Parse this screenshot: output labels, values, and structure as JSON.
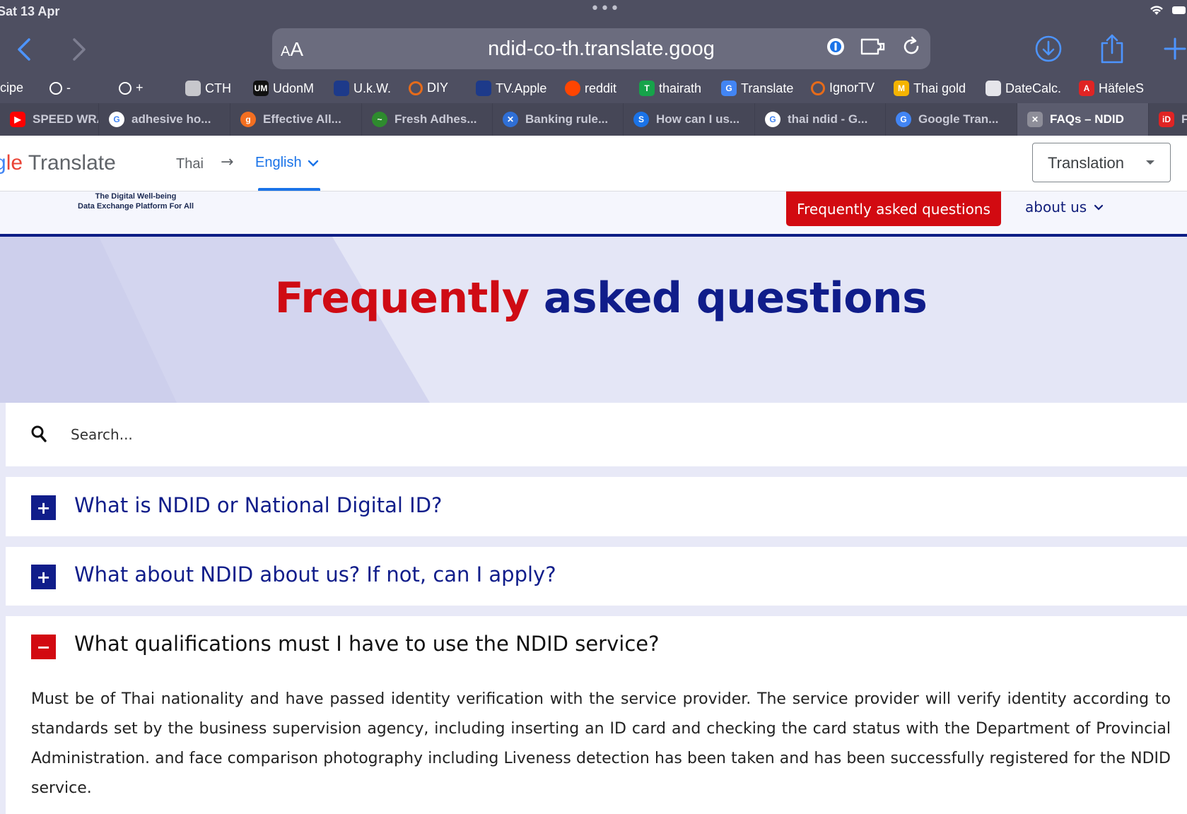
{
  "status": {
    "time": "Sat 13 Apr"
  },
  "url_bar": {
    "aa_small": "A",
    "aa_big": "A",
    "url": "ndid-co-th.translate.goog"
  },
  "bookmarks": [
    {
      "label": "ecipe",
      "icon": "recipe-icon",
      "color": "#4e4f61"
    },
    {
      "label": "-",
      "icon": "globe-icon",
      "color": "#4e4f61"
    },
    {
      "label": "+",
      "icon": "globe-icon",
      "color": "#4e4f61"
    },
    {
      "label": "CTH",
      "icon": "apple-icon",
      "color": "#c7c7cc"
    },
    {
      "label": "UdonM",
      "icon": "um-icon",
      "color": "#111111",
      "glyph": "UM"
    },
    {
      "label": "U.k.W.",
      "icon": "uk-flag-icon",
      "color": "#1d3a8a"
    },
    {
      "label": "DIY",
      "icon": "ring-icon",
      "color": "#e66b1a"
    },
    {
      "label": "TV.Apple",
      "icon": "uk-flag-icon",
      "color": "#1d3a8a"
    },
    {
      "label": "reddit",
      "icon": "reddit-icon",
      "color": "#ff4500"
    },
    {
      "label": "thairath",
      "icon": "thairath-icon",
      "color": "#16a34a",
      "glyph": "T"
    },
    {
      "label": "Translate",
      "icon": "google-translate-icon",
      "color": "#4285f4",
      "glyph": "G"
    },
    {
      "label": "IgnorTV",
      "icon": "ring-icon",
      "color": "#e66b1a"
    },
    {
      "label": "Thai gold",
      "icon": "gold-icon",
      "color": "#f5b400",
      "glyph": "M"
    },
    {
      "label": "DateCalc.",
      "icon": "datecalc-icon",
      "color": "#e5e5ea"
    },
    {
      "label": "HäfeleS",
      "icon": "hafele-icon",
      "color": "#e02424",
      "glyph": "A"
    }
  ],
  "tabs": [
    {
      "label": "SPEED WRA",
      "icon": "youtube-icon",
      "color": "#ff0000",
      "glyph": "▶"
    },
    {
      "label": "adhesive ho...",
      "icon": "google-icon",
      "color": "#ffffff",
      "glyph": "G"
    },
    {
      "label": "Effective All...",
      "icon": "gsk-icon",
      "color": "#f36f21",
      "glyph": "g"
    },
    {
      "label": "Fresh Adhes...",
      "icon": "fresh-icon",
      "color": "#2e8b2e",
      "glyph": "~"
    },
    {
      "label": "Banking rule...",
      "icon": "banking-icon",
      "color": "#2f6fd6",
      "glyph": "✕"
    },
    {
      "label": "How can I us...",
      "icon": "skype-icon",
      "color": "#1a73e8",
      "glyph": "S"
    },
    {
      "label": "thai ndid - G...",
      "icon": "google-icon",
      "color": "#ffffff",
      "glyph": "G"
    },
    {
      "label": "Google Tran...",
      "icon": "google-translate-icon",
      "color": "#4285f4",
      "glyph": "G"
    },
    {
      "label": "FAQs – NDID",
      "icon": "close-icon",
      "color": "#8e8e99",
      "glyph": "✕"
    },
    {
      "label": "F",
      "icon": "id-icon",
      "color": "#e02424",
      "glyph": "iD"
    }
  ],
  "gt": {
    "logo_g": "g",
    "logo_le": "le",
    "logo_translate": " Translate",
    "from_lang": "Thai",
    "arrow": "→",
    "to_lang": "English",
    "mode": "Translation"
  },
  "site": {
    "tagline_1": "The Digital Well-being",
    "tagline_2": "Data Exchange Platform For All",
    "nav_faq": "Frequently asked questions",
    "nav_about": "about us"
  },
  "hero": {
    "title_red": "Frequently",
    "title_blue": " asked questions"
  },
  "search": {
    "placeholder": "Search..."
  },
  "faqs": [
    {
      "question": "What is NDID or National Digital ID?",
      "toggle": "+",
      "expanded": false
    },
    {
      "question": "What about NDID about us? If not, can I apply?",
      "toggle": "+",
      "expanded": false
    },
    {
      "question": "What qualifications must I have to use the NDID service?",
      "toggle": "−",
      "expanded": true,
      "answer": "Must be of Thai nationality and have passed identity verification with the service provider. The service provider will verify identity according to standards set by the business supervision agency, including inserting an ID card and checking the card status with the Department of Provincial Administration. and face comparison photography including Liveness detection has been taken and has been successfully registered for the NDID service."
    }
  ],
  "colors": {
    "ndid_red": "#d20a11",
    "ndid_blue": "#101d8a",
    "chrome": "#4e4f61",
    "link_blue": "#1a73e8"
  }
}
